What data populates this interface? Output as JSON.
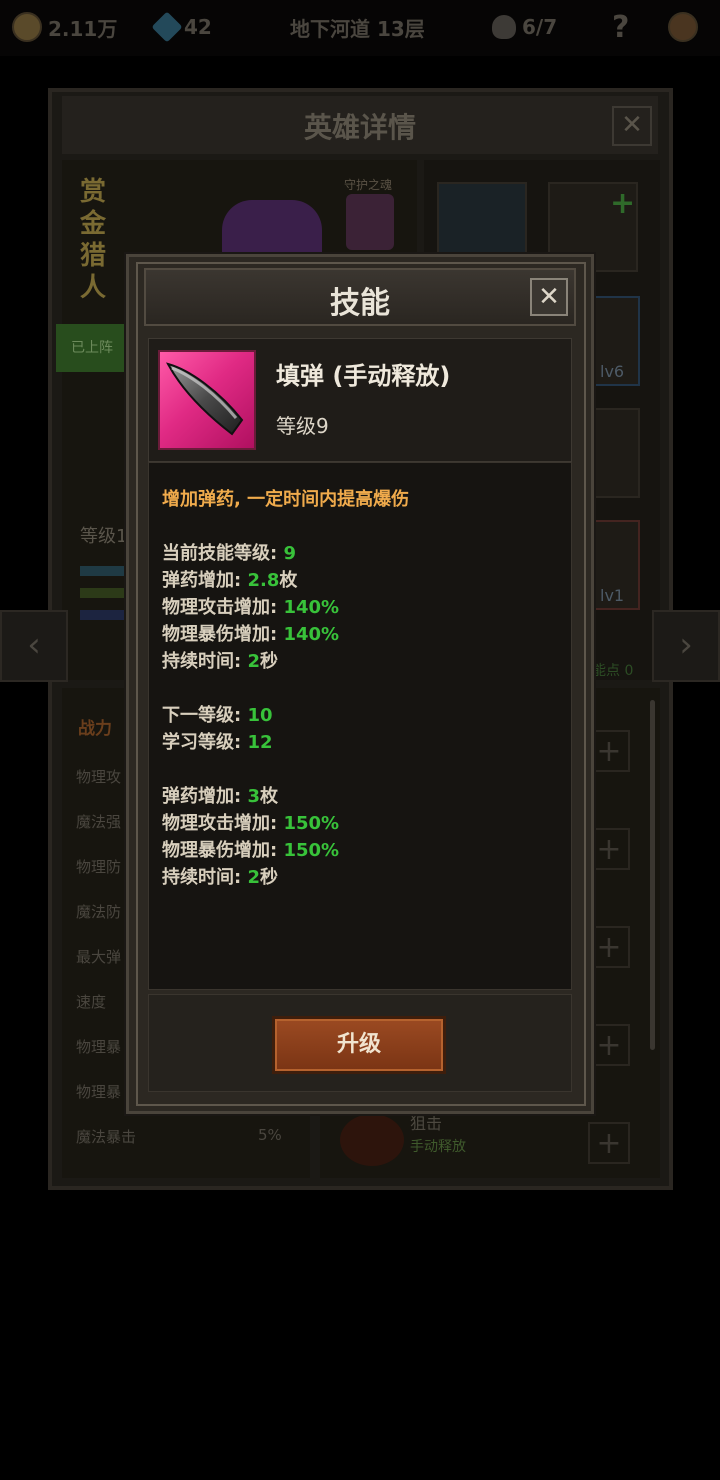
{
  "topbar": {
    "gold": "2.11万",
    "gems": "42",
    "location": "地下河道 13层",
    "skulls": "6/7",
    "help": "?"
  },
  "hero_panel": {
    "title": "英雄详情",
    "close": "✕",
    "hero_name": "赏金猎人",
    "guardian_label": "守护之魂",
    "deployed_tag": "已上阵",
    "level_label": "等级1",
    "equip_plus": "+",
    "equip_levels": [
      "lv6",
      "lv1"
    ],
    "nav_left": "‹",
    "nav_right": "›",
    "stats_header": "战力",
    "stats": [
      {
        "label": "物理攻",
        "value": ""
      },
      {
        "label": "魔法强",
        "value": ""
      },
      {
        "label": "物理防",
        "value": ""
      },
      {
        "label": "魔法防",
        "value": ""
      },
      {
        "label": "最大弹",
        "value": ""
      },
      {
        "label": "速度",
        "value": ""
      },
      {
        "label": "物理暴",
        "value": ""
      },
      {
        "label": "物理暴",
        "value": ""
      },
      {
        "label": "魔法暴击",
        "value": "5%"
      }
    ],
    "skill_points": "能点 0",
    "skill_plus": "+",
    "bottom_skill": {
      "name": "狙击",
      "type": "手动释放"
    }
  },
  "dialog": {
    "title": "技能",
    "close": "✕",
    "skill_name": "填弹 (手动释放)",
    "skill_level": "等级9",
    "icon": "bullet-icon",
    "intro": "增加弹药, 一定时间内提高爆伤",
    "current": [
      {
        "label": "当前技能等级: ",
        "value": "9",
        "suffix": ""
      },
      {
        "label": "弹药增加: ",
        "value": "2.8",
        "suffix": "枚"
      },
      {
        "label": "物理攻击增加: ",
        "value": "140%",
        "suffix": ""
      },
      {
        "label": "物理暴伤增加: ",
        "value": "140%",
        "suffix": ""
      },
      {
        "label": "持续时间: ",
        "value": "2",
        "suffix": "秒"
      }
    ],
    "next": [
      {
        "label": "下一等级: ",
        "value": "10",
        "suffix": ""
      },
      {
        "label": "学习等级: ",
        "value": "12",
        "suffix": ""
      }
    ],
    "next_effects": [
      {
        "label": "弹药增加: ",
        "value": "3",
        "suffix": "枚"
      },
      {
        "label": "物理攻击增加: ",
        "value": "150%",
        "suffix": ""
      },
      {
        "label": "物理暴伤增加: ",
        "value": "150%",
        "suffix": ""
      },
      {
        "label": "持续时间: ",
        "value": "2",
        "suffix": "秒"
      }
    ],
    "upgrade_button": "升级"
  },
  "colors": {
    "value_green": "#38c23a",
    "intro_orange": "#f0ab4c",
    "button_brown": "#8a3c1a"
  }
}
